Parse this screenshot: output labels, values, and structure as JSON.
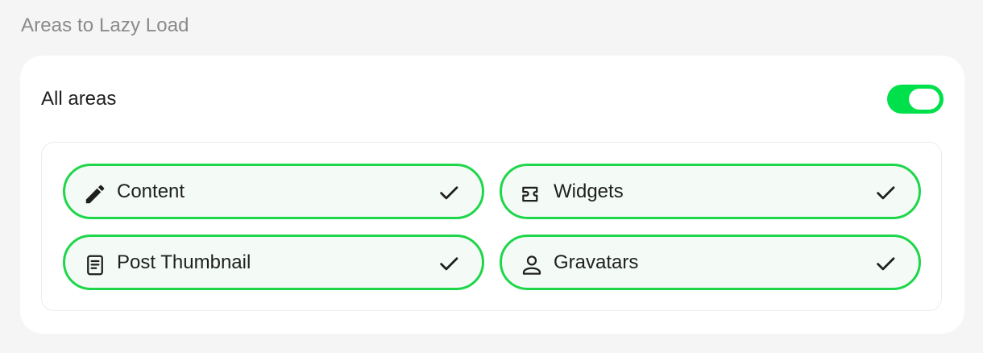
{
  "section": {
    "title": "Areas to Lazy Load"
  },
  "all_areas": {
    "label": "All areas",
    "enabled": true
  },
  "areas": [
    {
      "label": "Content",
      "icon": "pencil-icon",
      "checked": true
    },
    {
      "label": "Widgets",
      "icon": "widget-icon",
      "checked": true
    },
    {
      "label": "Post Thumbnail",
      "icon": "document-icon",
      "checked": true
    },
    {
      "label": "Gravatars",
      "icon": "user-icon",
      "checked": true
    }
  ],
  "colors": {
    "accent": "#00e04a",
    "item_border": "#1ed64a",
    "item_background": "#f4fbf6",
    "page_background": "#f5f5f5"
  }
}
